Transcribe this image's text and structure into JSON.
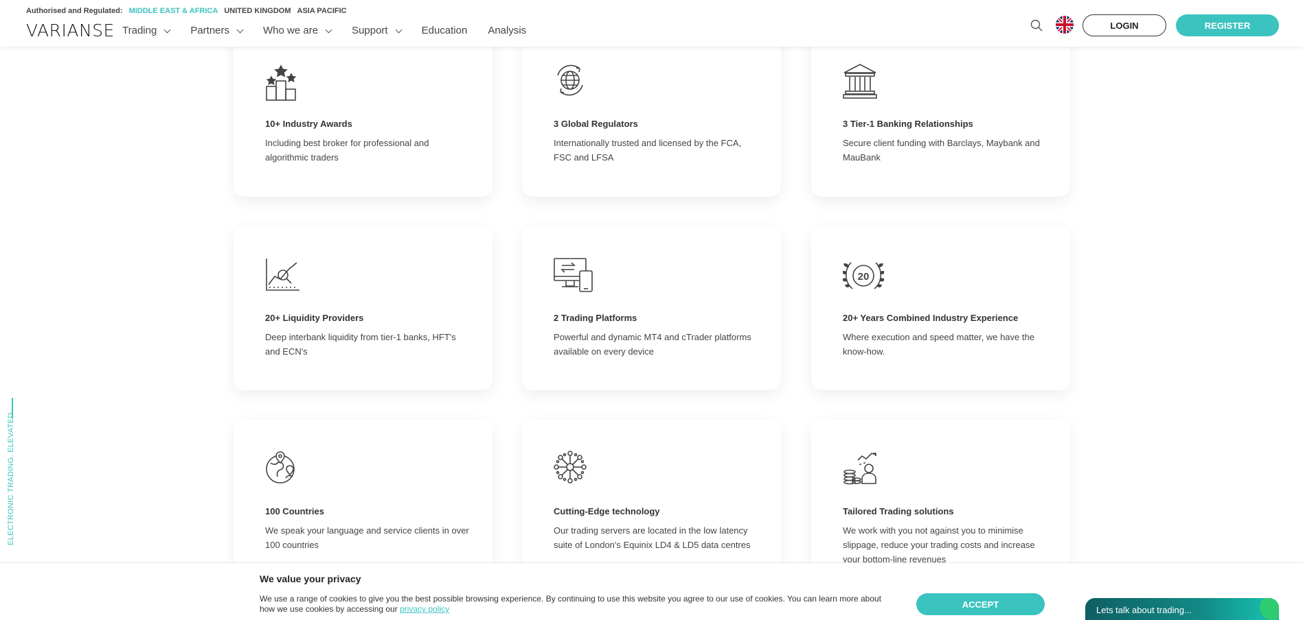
{
  "regulation": {
    "label": "Authorised and Regulated:",
    "regions": [
      "MIDDLE EAST & AFRICA",
      "UNITED KINGDOM",
      "ASIA PACIFIC"
    ],
    "active_region": "MIDDLE EAST & AFRICA"
  },
  "logo": "VARIANSE",
  "nav": {
    "items": [
      {
        "label": "Trading",
        "dropdown": true
      },
      {
        "label": "Partners",
        "dropdown": true
      },
      {
        "label": "Who we are",
        "dropdown": true
      },
      {
        "label": "Support",
        "dropdown": true
      },
      {
        "label": "Education",
        "dropdown": false
      },
      {
        "label": "Analysis",
        "dropdown": false
      }
    ]
  },
  "header": {
    "login_label": "LOGIN",
    "register_label": "REGISTER",
    "language_icon": "uk-flag-icon",
    "search_icon": "search-icon"
  },
  "side_tagline": "ELECTRONIC TRADING. ELEVATED",
  "cards": [
    {
      "icon": "awards-podium-icon",
      "title": "10+ Industry Awards",
      "desc": "Including best broker for professional and algorithmic traders"
    },
    {
      "icon": "globe-regulators-icon",
      "title": "3 Global Regulators",
      "desc": "Internationally trusted and licensed by the FCA, FSC and LFSA"
    },
    {
      "icon": "bank-icon",
      "title": "3 Tier-1 Banking Relationships",
      "desc": "Secure client funding with Barclays, Maybank and MauBank"
    },
    {
      "icon": "liquidity-chart-icon",
      "title": "20+ Liquidity Providers",
      "desc": "Deep interbank liquidity from tier-1 banks, HFT's and ECN's"
    },
    {
      "icon": "devices-platform-icon",
      "title": "2 Trading Platforms",
      "desc": "Powerful and dynamic MT4 and cTrader platforms available on every device"
    },
    {
      "icon": "laurel-20-icon",
      "title": "20+ Years Combined Industry Experience",
      "desc": "Where execution and speed matter, we have the know-how."
    },
    {
      "icon": "world-pins-icon",
      "title": "100 Countries",
      "desc": "We speak your language and service clients in over 100 countries"
    },
    {
      "icon": "network-technology-icon",
      "title": "Cutting-Edge technology",
      "desc": "Our trading servers are located in the low latency suite of London's Equinix LD4 & LD5 data centres"
    },
    {
      "icon": "tailored-solutions-icon",
      "title": "Tailored Trading solutions",
      "desc": "We work with you not against you to minimise slippage, reduce your trading costs and increase your bottom-line revenues"
    }
  ],
  "cookie": {
    "title": "We value your privacy",
    "text": "We use a range of cookies to give you the best possible browsing experience. By continuing to use this website you agree to our use of cookies. You can learn more about how we use cookies by accessing our ",
    "link": "privacy policy",
    "accept_label": "ACCEPT"
  },
  "chat": {
    "label": "Lets talk about trading..."
  },
  "colors": {
    "accent": "#3bc3c0",
    "text": "#333333"
  }
}
